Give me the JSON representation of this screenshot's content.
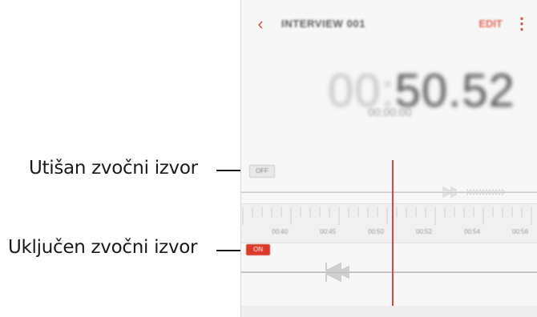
{
  "callouts": {
    "muted": "Utišan zvočni izvor",
    "enabled": "Uključen zvočni izvor"
  },
  "appbar": {
    "back_icon": "chevron-left-icon",
    "back_glyph": "‹",
    "title": "INTERVIEW 001",
    "edit_label": "EDIT",
    "more_icon": "more-vertical-icon",
    "more_glyph": "⋮"
  },
  "timer": {
    "main_prefix": "00:",
    "main_value": "50",
    "main_suffix": ".52",
    "sub": "00:00:00"
  },
  "tracks": {
    "muted_label": "OFF",
    "enabled_label": "ON"
  },
  "ruler": {
    "labels": [
      "00:40",
      "00:45",
      "00:50",
      "00:52",
      "00:54",
      "00:56"
    ]
  },
  "colors": {
    "accent": "#e0473a",
    "text": "#1a1a1a"
  }
}
